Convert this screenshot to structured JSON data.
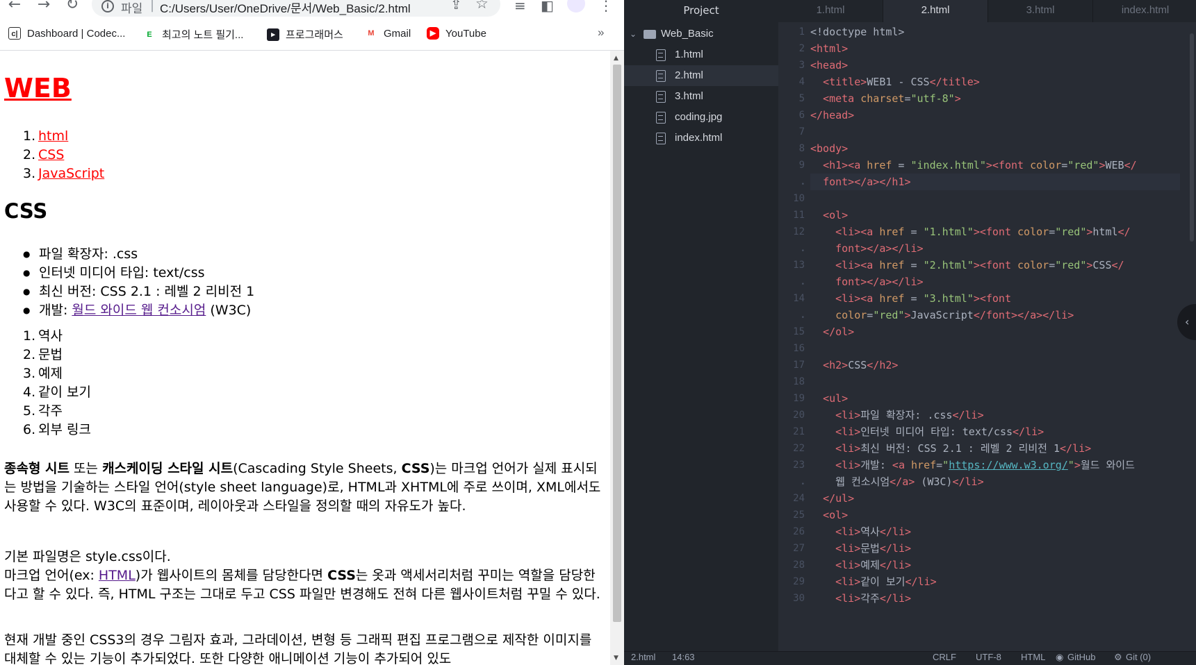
{
  "browser": {
    "nav": {
      "back": "←",
      "forward": "→",
      "reload": "↻"
    },
    "omnibox": {
      "info": "i",
      "scheme": "파일",
      "separator": "|",
      "url": "C:/Users/User/OneDrive/문서/Web_Basic/2.html",
      "share_icon": "⇪",
      "star_icon": "☆"
    },
    "right_icons": {
      "media": "≡",
      "sidepanel": "◧",
      "menu": "⋮"
    },
    "bookmarks": [
      {
        "label": "Dashboard | Codec...",
        "icon": "c|",
        "icon_color": "#2b2b2b"
      },
      {
        "label": "최고의 노트 필기...",
        "icon": "E",
        "icon_color": "#00a82d"
      },
      {
        "label": "프로그래머스",
        "icon": "▸",
        "icon_color": "#1b1c25"
      },
      {
        "label": "Gmail",
        "icon": "M",
        "icon_color": "#ea4335"
      },
      {
        "label": "YouTube",
        "icon": "▶",
        "icon_color": "#ff0000"
      }
    ],
    "bookmarks_more": "»",
    "page": {
      "h1": "WEB",
      "nav_items": [
        "html",
        "CSS",
        "JavaScript"
      ],
      "h2": "CSS",
      "bullets": [
        {
          "text": "파일 확장자: .css"
        },
        {
          "text": "인터넷 미디어 타입: text/css"
        },
        {
          "text": "최신 버전: CSS 2.1 : 레벨 2 리비전 1"
        },
        {
          "prefix": "개발: ",
          "link": "월드 와이드 웹 컨소시엄",
          "suffix": " (W3C)"
        }
      ],
      "ordered": [
        "역사",
        "문법",
        "예제",
        "같이 보기",
        "각주",
        "외부 링크"
      ],
      "p1": {
        "b1": "종속형 시트",
        "t1": " 또는 ",
        "b2": "캐스케이딩 스타일 시트",
        "t2": "(Cascading Style Sheets, ",
        "b3": "CSS",
        "t3": ")는 마크업 언어가 실제 표시되는 방법을 기술하는 스타일 언어(style sheet language)로, HTML과 XHTML에 주로 쓰이며, XML에서도 사용할 수 있다. W3C의 표준이며, 레이아웃과 스타일을 정의할 때의 자유도가 높다."
      },
      "p2": {
        "line1": "기본 파일명은 style.css이다.",
        "t1": "마크업 언어(ex: ",
        "link": "HTML",
        "t2": ")가 웹사이트의 몸체를 담당한다면 ",
        "b1": "CSS",
        "t3": "는 옷과 액세서리처럼 꾸미는 역할을 담당한다고 할 수 있다. 즉, HTML 구조는 그대로 두고 CSS 파일만 변경해도 전혀 다른 웹사이트처럼 꾸밀 수 있다."
      },
      "p3": "현재 개발 중인 CSS3의 경우 그림자 효과, 그라데이션, 변형 등 그래픽 편집 프로그램으로 제작한 이미지를 대체할 수 있는 기능이 추가되었다. 또한 다양한 애니메이션 기능이 추가되어 있도"
    }
  },
  "editor": {
    "tree_title": "Project",
    "folder": "Web_Basic",
    "files": [
      "1.html",
      "2.html",
      "3.html",
      "coding.jpg",
      "index.html"
    ],
    "selected_file": "2.html",
    "tabs": [
      "1.html",
      "2.html",
      "3.html",
      "index.html"
    ],
    "active_tab": "2.html",
    "lines": [
      {
        "n": "1",
        "code": "<span class='p'>&lt;!doctype html&gt;</span>"
      },
      {
        "n": "2",
        "code": "<span class='t'>&lt;html&gt;</span>"
      },
      {
        "n": "3",
        "code": "<span class='t'>&lt;head&gt;</span>"
      },
      {
        "n": "4",
        "code": "  <span class='t'>&lt;title&gt;</span>WEB1 - CSS<span class='t'>&lt;/title&gt;</span>"
      },
      {
        "n": "5",
        "code": "  <span class='t'>&lt;meta</span> <span class='at'>charset</span>=<span class='s'>\"utf-8\"</span><span class='t'>&gt;</span>"
      },
      {
        "n": "6",
        "code": "<span class='t'>&lt;/head&gt;</span>"
      },
      {
        "n": "7",
        "code": ""
      },
      {
        "n": "8",
        "code": "<span class='t'>&lt;body&gt;</span>"
      },
      {
        "n": "9",
        "code": "  <span class='t'>&lt;h1&gt;&lt;a</span> <span class='at'>href</span> = <span class='s'>\"index.html\"</span><span class='t'>&gt;&lt;font</span> <span class='at'>color</span>=<span class='s'>\"red\"</span><span class='t'>&gt;</span>WEB<span class='t'>&lt;/</span>"
      },
      {
        "n": "•",
        "code": "  <span class='t'>font&gt;&lt;/a&gt;&lt;/h1&gt;</span>",
        "hl": true
      },
      {
        "n": "10",
        "code": ""
      },
      {
        "n": "11",
        "code": "  <span class='t'>&lt;ol&gt;</span>"
      },
      {
        "n": "12",
        "code": "    <span class='t'>&lt;li&gt;&lt;a</span> <span class='at'>href</span> = <span class='s'>\"1.html\"</span><span class='t'>&gt;&lt;font</span> <span class='at'>color</span>=<span class='s'>\"red\"</span><span class='t'>&gt;</span>html<span class='t'>&lt;/</span>"
      },
      {
        "n": "•",
        "code": "    <span class='t'>font&gt;&lt;/a&gt;&lt;/li&gt;</span>"
      },
      {
        "n": "13",
        "code": "    <span class='t'>&lt;li&gt;&lt;a</span> <span class='at'>href</span> = <span class='s'>\"2.html\"</span><span class='t'>&gt;&lt;font</span> <span class='at'>color</span>=<span class='s'>\"red\"</span><span class='t'>&gt;</span>CSS<span class='t'>&lt;/</span>"
      },
      {
        "n": "•",
        "code": "    <span class='t'>font&gt;&lt;/a&gt;&lt;/li&gt;</span>"
      },
      {
        "n": "14",
        "code": "    <span class='t'>&lt;li&gt;&lt;a</span> <span class='at'>href</span> = <span class='s'>\"3.html\"</span><span class='t'>&gt;&lt;font</span>"
      },
      {
        "n": "•",
        "code": "    <span class='at'>color</span>=<span class='s'>\"red\"</span><span class='t'>&gt;</span>JavaScript<span class='t'>&lt;/font&gt;&lt;/a&gt;&lt;/li&gt;</span>"
      },
      {
        "n": "15",
        "code": "  <span class='t'>&lt;/ol&gt;</span>"
      },
      {
        "n": "16",
        "code": ""
      },
      {
        "n": "17",
        "code": "  <span class='t'>&lt;h2&gt;</span>CSS<span class='t'>&lt;/h2&gt;</span>"
      },
      {
        "n": "18",
        "code": ""
      },
      {
        "n": "19",
        "code": "  <span class='t'>&lt;ul&gt;</span>"
      },
      {
        "n": "20",
        "code": "    <span class='t'>&lt;li&gt;</span>파일 확장자: .css<span class='t'>&lt;/li&gt;</span>"
      },
      {
        "n": "21",
        "code": "    <span class='t'>&lt;li&gt;</span>인터넷 미디어 타입: text/css<span class='t'>&lt;/li&gt;</span>"
      },
      {
        "n": "22",
        "code": "    <span class='t'>&lt;li&gt;</span>최신 버전: CSS 2.1 : 레벨 2 리비전 1<span class='t'>&lt;/li&gt;</span>"
      },
      {
        "n": "23",
        "code": "    <span class='t'>&lt;li&gt;</span>개발: <span class='t'>&lt;a</span> <span class='at'>href</span>=<span class='s'>\"</span><span class='u'>https://www.w3.org/</span><span class='s'>\"</span><span class='t'>&gt;</span>월드 와이드"
      },
      {
        "n": "•",
        "code": "    웹 컨소시엄<span class='t'>&lt;/a&gt;</span> (W3C)<span class='t'>&lt;/li&gt;</span>"
      },
      {
        "n": "24",
        "code": "  <span class='t'>&lt;/ul&gt;</span>"
      },
      {
        "n": "25",
        "code": "  <span class='t'>&lt;ol&gt;</span>"
      },
      {
        "n": "26",
        "code": "    <span class='t'>&lt;li&gt;</span>역사<span class='t'>&lt;/li&gt;</span>"
      },
      {
        "n": "27",
        "code": "    <span class='t'>&lt;li&gt;</span>문법<span class='t'>&lt;/li&gt;</span>"
      },
      {
        "n": "28",
        "code": "    <span class='t'>&lt;li&gt;</span>예제<span class='t'>&lt;/li&gt;</span>"
      },
      {
        "n": "29",
        "code": "    <span class='t'>&lt;li&gt;</span>같이 보기<span class='t'>&lt;/li&gt;</span>"
      },
      {
        "n": "30",
        "code": "    <span class='t'>&lt;li&gt;</span>각주<span class='t'>&lt;/li&gt;</span>"
      }
    ],
    "scroll_bubble": "‹",
    "status": {
      "file": "2.html",
      "cursor": "14:63",
      "eol": "CRLF",
      "encoding": "UTF-8",
      "grammar": "HTML",
      "github": "GitHub",
      "git": "Git (0)"
    }
  }
}
